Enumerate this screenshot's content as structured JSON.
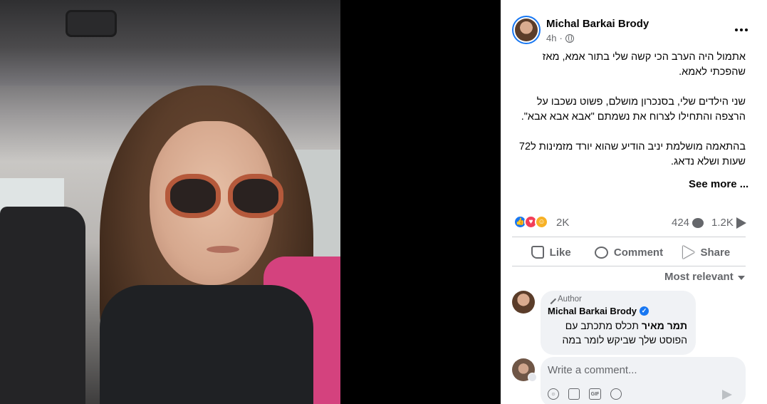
{
  "post": {
    "author": "Michal Barkai Brody",
    "time": "4h",
    "more_label": "...",
    "paragraphs": [
      "אתמול היה הערב הכי קשה שלי בתור אמא, מאז שהפכתי לאמא.",
      "שני הילדים שלי, בסנכרון מושלם, פשוט נשכבו על הרצפה והתחילו לצרוח את נשמתם \"אבא אבא אבא\".",
      "בהתאמה מושלמת יניב הודיע שהוא יורד מזמינות ל72 שעות ושלא נדאג."
    ],
    "see_more": "See more ..."
  },
  "stats": {
    "reactions_count": "2K",
    "comments_count": "424",
    "shares_count": "1.2K",
    "reaction_icons": [
      "like-icon",
      "love-icon",
      "care-icon"
    ]
  },
  "actions": {
    "like": "Like",
    "comment": "Comment",
    "share": "Share"
  },
  "comments": {
    "sort_label": "Most relevant",
    "items": [
      {
        "badge": "Author",
        "name": "Michal Barkai Brody",
        "tagged": "תמר מאיר",
        "text": " תכלס מתכתב עם הפוסט שלך שביקש לומר במה"
      }
    ],
    "write_placeholder": "Write a comment..."
  },
  "colors": {
    "accent": "#1877f2",
    "love": "#f33e58",
    "care": "#f7b125",
    "secondary_text": "#65676b"
  }
}
